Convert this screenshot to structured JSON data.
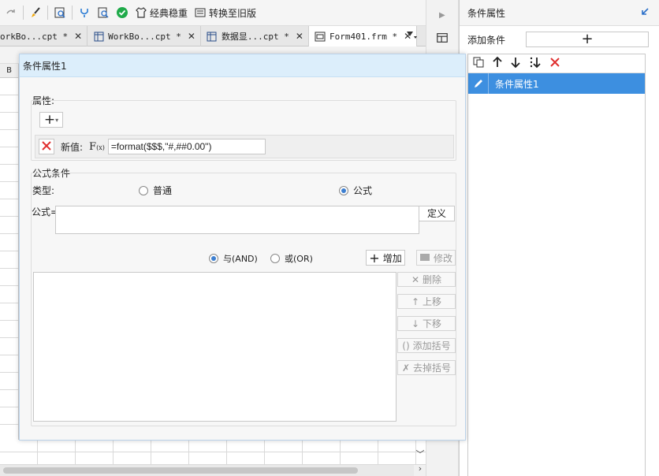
{
  "toolbar": {
    "items": [
      {
        "icon": "redo-icon",
        "label": ""
      },
      {
        "icon": "brush-icon",
        "label": ""
      },
      {
        "icon": "preview-icon",
        "label": ""
      },
      {
        "icon": "plugin-icon",
        "label": ""
      },
      {
        "icon": "search-doc-icon",
        "label": ""
      },
      {
        "icon": "check-circle-icon",
        "label": ""
      },
      {
        "icon": "shirt-icon",
        "label": "经典稳重"
      },
      {
        "icon": "convert-icon",
        "label": "转换至旧版"
      }
    ]
  },
  "tabs": [
    {
      "label": "orkBo...cpt *",
      "active": false
    },
    {
      "label": "WorkBo...cpt *",
      "active": false
    },
    {
      "label": "数据显...cpt *",
      "active": false
    },
    {
      "label": "Form401.frm *",
      "active": true
    }
  ],
  "grid": {
    "column_header": "B"
  },
  "dialog": {
    "title": "条件属性1",
    "properties_label": "属性:",
    "new_value_label": "新值:",
    "fx_label": "F",
    "fx_sub": "(x)",
    "new_value": "=format($$$,\"#,##0.00\")",
    "formula_condition_label": "公式条件",
    "type_label": "类型:",
    "type_options": [
      "普通",
      "公式"
    ],
    "type_selected": "公式",
    "formula_label": "公式=",
    "define_label": "定义",
    "and_label": "与(AND)",
    "or_label": "或(OR)",
    "logic_selected": "and",
    "add_label": "增加",
    "modify_label": "修改",
    "delete_label": "删除",
    "move_up_label": "上移",
    "move_down_label": "下移",
    "add_bracket_label": "添加括号",
    "remove_bracket_label": "去掉括号"
  },
  "right_panel": {
    "title": "条件属性",
    "add_condition_label": "添加条件",
    "items": [
      "条件属性1"
    ]
  },
  "colors": {
    "accent": "#3d8fe0",
    "dialog_title_bg": "#dceefb",
    "delete_red": "#e03030"
  }
}
